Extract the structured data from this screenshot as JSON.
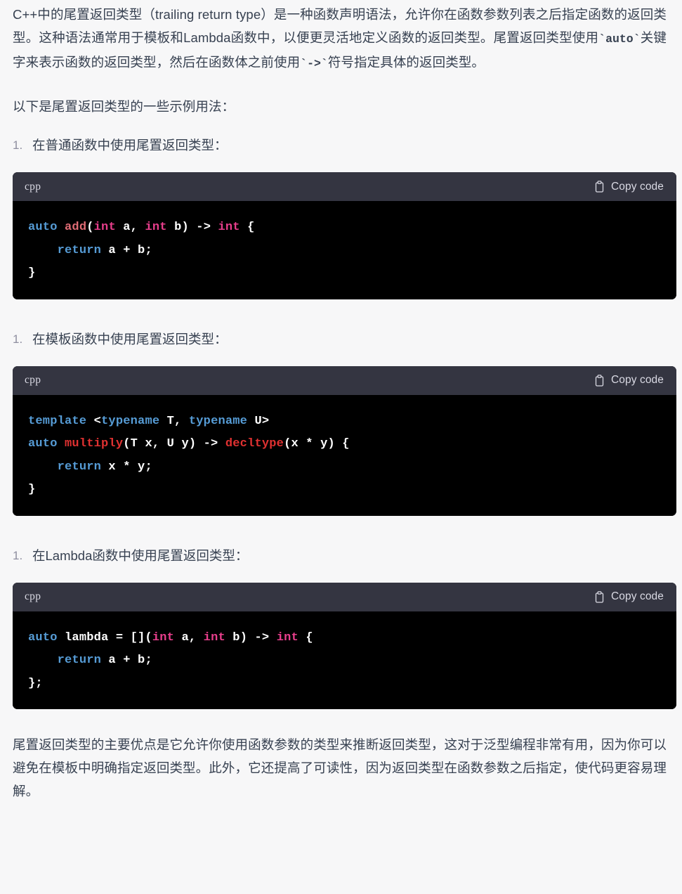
{
  "document": {
    "paragraphs": {
      "intro": "C++中的尾置返回类型（trailing return type）是一种函数声明语法，允许你在函数参数列表之后指定函数的返回类型。这种语法通常用于模板和Lambda函数中，以便更灵活地定义函数的返回类型。尾置返回类型使用",
      "intro_code_1": "`auto`",
      "intro_mid": "关键字来表示函数的返回类型，然后在函数体之前使用",
      "intro_code_2": "`->`",
      "intro_end": "符号指定具体的返回类型。",
      "examples_lead": "以下是尾置返回类型的一些示例用法：",
      "conclusion": "尾置返回类型的主要优点是它允许你使用函数参数的类型来推断返回类型，这对于泛型编程非常有用，因为你可以避免在模板中明确指定返回类型。此外，它还提高了可读性，因为返回类型在函数参数之后指定，使代码更容易理解。"
    },
    "sections": [
      {
        "list_item": "在普通函数中使用尾置返回类型：",
        "code": {
          "language_label": "cpp",
          "copy_label": "Copy code",
          "copy_icon": "clipboard-icon",
          "lines": [
            [
              {
                "t": "auto",
                "c": "key"
              },
              {
                "t": " ",
                "c": "plain"
              },
              {
                "t": "add",
                "c": "fn"
              },
              {
                "t": "(",
                "c": "plain"
              },
              {
                "t": "int",
                "c": "type"
              },
              {
                "t": " a, ",
                "c": "plain"
              },
              {
                "t": "int",
                "c": "type"
              },
              {
                "t": " b) -> ",
                "c": "plain"
              },
              {
                "t": "int",
                "c": "type"
              },
              {
                "t": " {",
                "c": "plain"
              }
            ],
            [
              {
                "t": "    ",
                "c": "plain"
              },
              {
                "t": "return",
                "c": "key"
              },
              {
                "t": " a + b;",
                "c": "plain"
              }
            ],
            [
              {
                "t": "}",
                "c": "plain"
              }
            ]
          ],
          "plain_text": "auto add(int a, int b) -> int {\n    return a + b;\n}"
        }
      },
      {
        "list_item": "在模板函数中使用尾置返回类型：",
        "code": {
          "language_label": "cpp",
          "copy_label": "Copy code",
          "copy_icon": "clipboard-icon",
          "lines": [
            [
              {
                "t": "template",
                "c": "key"
              },
              {
                "t": " <",
                "c": "plain"
              },
              {
                "t": "typename",
                "c": "key"
              },
              {
                "t": " T, ",
                "c": "plain"
              },
              {
                "t": "typename",
                "c": "key"
              },
              {
                "t": " U>",
                "c": "plain"
              }
            ],
            [
              {
                "t": "auto",
                "c": "key"
              },
              {
                "t": " ",
                "c": "plain"
              },
              {
                "t": "multiply",
                "c": "fn2"
              },
              {
                "t": "(T x, U y) -> ",
                "c": "plain"
              },
              {
                "t": "decltype",
                "c": "fn2"
              },
              {
                "t": "(x * y) {",
                "c": "plain"
              }
            ],
            [
              {
                "t": "    ",
                "c": "plain"
              },
              {
                "t": "return",
                "c": "key"
              },
              {
                "t": " x * y;",
                "c": "plain"
              }
            ],
            [
              {
                "t": "}",
                "c": "plain"
              }
            ]
          ],
          "plain_text": "template <typename T, typename U>\nauto multiply(T x, U y) -> decltype(x * y) {\n    return x * y;\n}"
        }
      },
      {
        "list_item": "在Lambda函数中使用尾置返回类型：",
        "code": {
          "language_label": "cpp",
          "copy_label": "Copy code",
          "copy_icon": "clipboard-icon",
          "lines": [
            [
              {
                "t": "auto",
                "c": "key"
              },
              {
                "t": " lambda = [](",
                "c": "plain"
              },
              {
                "t": "int",
                "c": "type"
              },
              {
                "t": " a, ",
                "c": "plain"
              },
              {
                "t": "int",
                "c": "type"
              },
              {
                "t": " b) -> ",
                "c": "plain"
              },
              {
                "t": "int",
                "c": "type"
              },
              {
                "t": " {",
                "c": "plain"
              }
            ],
            [
              {
                "t": "    ",
                "c": "plain"
              },
              {
                "t": "return",
                "c": "key"
              },
              {
                "t": " a + b;",
                "c": "plain"
              }
            ],
            [
              {
                "t": "};",
                "c": "plain"
              }
            ]
          ],
          "plain_text": "auto lambda = [](int a, int b) -> int {\n    return a + b;\n};"
        }
      }
    ]
  },
  "colors": {
    "page_background": "#f7f7f8",
    "body_text": "#374151",
    "code_header_bg": "#343541",
    "code_body_bg": "#000000",
    "code_text": "#ffffff",
    "keyword": "#569cd6",
    "function_name": "#e06c75",
    "function_name_alt": "#e03131",
    "type_name": "#e83e8c",
    "list_marker": "#8e8ea0",
    "code_header_text": "#d9d9e3"
  }
}
